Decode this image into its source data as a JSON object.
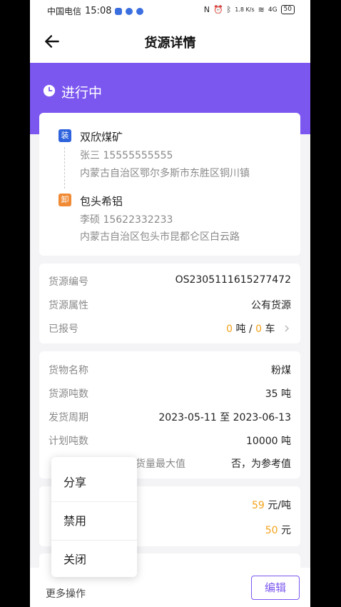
{
  "status_bar": {
    "carrier": "中国电信",
    "time": "15:08",
    "net_speed": "1.8 K/s",
    "signal": "4G",
    "battery": "50"
  },
  "nav": {
    "title": "货源详情"
  },
  "banner": {
    "status": "进行中",
    "color": "#7b57f0"
  },
  "route": {
    "load": {
      "badge": "装",
      "name": "双欣煤矿",
      "contact": "张三 15555555555",
      "address": "内蒙古自治区鄂尔多斯市东胜区铜川镇"
    },
    "unload": {
      "badge": "卸",
      "name": "包头希铝",
      "contact": "李硕 15622332233",
      "address": "内蒙古自治区包头市昆都仑区白云路"
    }
  },
  "source_info": {
    "no_label": "货源编号",
    "no_value": "OS2305111615277472",
    "attr_label": "货源属性",
    "attr_value": "公有货源",
    "reported_label": "已报号",
    "reported_tons": "0",
    "tons_unit": " 吨 / ",
    "reported_cars": "0",
    "cars_unit": " 车"
  },
  "goods": {
    "name_label": "货物名称",
    "name_value": "粉煤",
    "tonnage_label": "货源吨数",
    "tonnage_value": "35 吨",
    "period_label": "发货周期",
    "period_value": "2023-05-11 至 2023-06-13",
    "plan_label": "计划吨数",
    "plan_value": "10000 吨",
    "max_label": "货量最大值",
    "max_value": "否，为参考值"
  },
  "pricing": {
    "price_value": "59",
    "price_unit": " 元/吨",
    "fee_value": "50",
    "fee_unit": " 元"
  },
  "popup_menu": {
    "items": [
      "分享",
      "禁用",
      "关闭"
    ]
  },
  "bottom": {
    "more_ops": "更多操作",
    "edit": "编辑"
  },
  "colors": {
    "accent": "#7b57f0",
    "orange": "#f3a21a",
    "load_badge": "#2e63dd",
    "unload_badge": "#f08a35"
  }
}
